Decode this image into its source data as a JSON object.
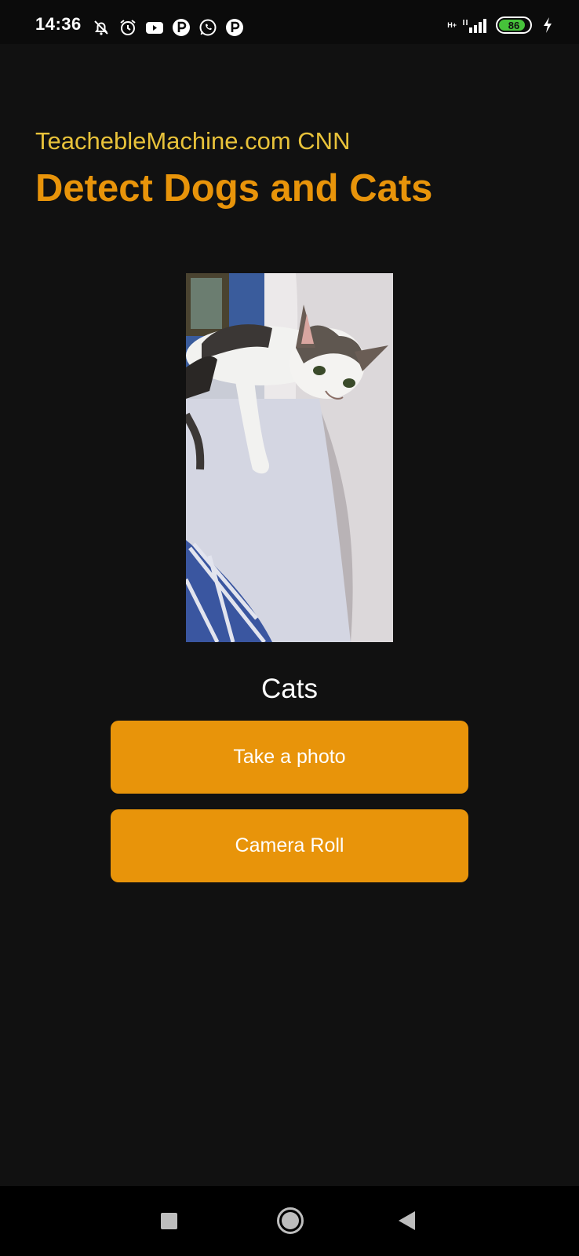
{
  "status_bar": {
    "time": "14:36",
    "network_label": "H+",
    "battery_percent": 86,
    "battery_text": "86",
    "icons_left": [
      "muted-bell-icon",
      "alarm-icon",
      "youtube-icon",
      "p-app-icon",
      "whatsapp-icon",
      "p-app-icon"
    ],
    "icons_right": [
      "signal-icon",
      "battery-icon",
      "charging-icon"
    ]
  },
  "header": {
    "subtitle": "TeachebleMachine.com CNN",
    "title": "Detect Dogs and Cats"
  },
  "prediction": {
    "label": "Cats"
  },
  "buttons": {
    "take_photo": "Take a photo",
    "camera_roll": "Camera Roll"
  },
  "colors": {
    "background": "#111111",
    "accent": "#e8940a",
    "subtitle": "#e8c23a",
    "battery": "#46c23a"
  },
  "nav": {
    "icons": [
      "recents-square-icon",
      "home-circle-icon",
      "back-triangle-icon"
    ]
  }
}
